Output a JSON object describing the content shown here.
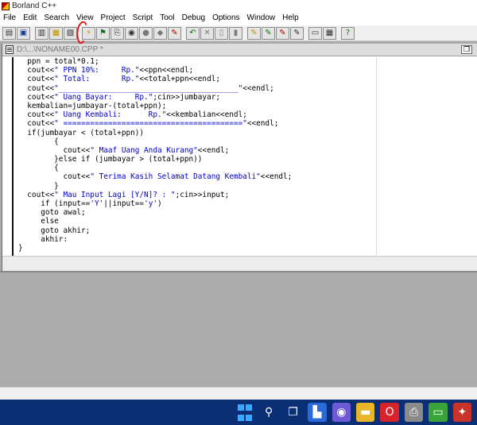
{
  "app": {
    "title": "Borland C++"
  },
  "menu": [
    "File",
    "Edit",
    "Search",
    "View",
    "Project",
    "Script",
    "Tool",
    "Debug",
    "Options",
    "Window",
    "Help"
  ],
  "toolbar": {
    "groups": [
      [
        {
          "name": "new-file-icon",
          "glyph": "▤",
          "tone": "i-dark"
        },
        {
          "name": "open-project-icon",
          "glyph": "▣",
          "tone": "i-blue"
        }
      ],
      [
        {
          "name": "open-file-icon",
          "glyph": "▥",
          "tone": "i-dark"
        },
        {
          "name": "open-folder-icon",
          "glyph": "▦",
          "tone": "i-yellow"
        },
        {
          "name": "save-icon",
          "glyph": "▧",
          "tone": "i-dark"
        }
      ],
      [
        {
          "name": "make-icon",
          "glyph": "⚡",
          "tone": "i-yellow"
        },
        {
          "name": "build-icon",
          "glyph": "⚑",
          "tone": "i-green"
        },
        {
          "name": "compile-icon",
          "glyph": "⎘",
          "tone": "i-dark"
        },
        {
          "name": "run-icon",
          "glyph": "◉",
          "tone": "i-dark"
        },
        {
          "name": "stop-icon",
          "glyph": "●",
          "tone": "i-gray"
        },
        {
          "name": "pause-icon",
          "glyph": "◆",
          "tone": "i-gray"
        },
        {
          "name": "step-icon",
          "glyph": "✎",
          "tone": "i-red"
        }
      ],
      [
        {
          "name": "undo-icon",
          "glyph": "↶",
          "tone": "i-green"
        },
        {
          "name": "cut-icon",
          "glyph": "✕",
          "tone": "i-gray"
        },
        {
          "name": "copy-icon",
          "glyph": "▯",
          "tone": "i-gray"
        },
        {
          "name": "paste-icon",
          "glyph": "▮",
          "tone": "i-gray"
        }
      ],
      [
        {
          "name": "find-icon",
          "glyph": "✎",
          "tone": "i-yellow"
        },
        {
          "name": "find-next-icon",
          "glyph": "✎",
          "tone": "i-green"
        },
        {
          "name": "replace-icon",
          "glyph": "✎",
          "tone": "i-red"
        },
        {
          "name": "search-again-icon",
          "glyph": "✎",
          "tone": "i-dark"
        }
      ],
      [
        {
          "name": "message-window-icon",
          "glyph": "▭",
          "tone": "i-dark"
        },
        {
          "name": "project-window-icon",
          "glyph": "▦",
          "tone": "i-dark"
        }
      ],
      [
        {
          "name": "help-icon",
          "glyph": "?",
          "tone": "i-green"
        }
      ]
    ]
  },
  "editor": {
    "title": "D:\\...\\NONAME00.CPP *",
    "restore_glyph": "❐",
    "lines": [
      [
        {
          "t": "  ppn = total*0.1;"
        }
      ],
      [
        {
          "t": "  cout<<"
        },
        {
          "t": "\" PPN 10%:     Rp.\"",
          "s": 1
        },
        {
          "t": "<<ppn<<endl;"
        }
      ],
      [
        {
          "t": "  cout<<"
        },
        {
          "t": "\" Total:       Rp.\"",
          "s": 1
        },
        {
          "t": "<<total+ppn<<endl;"
        }
      ],
      [
        {
          "t": "  cout<<"
        },
        {
          "t": "\"________________________________________\"",
          "s": 1
        },
        {
          "t": "<<endl;"
        }
      ],
      [
        {
          "t": "  cout<<"
        },
        {
          "t": "\" Uang Bayar:     Rp.\"",
          "s": 1
        },
        {
          "t": ";cin>>jumbayar;"
        }
      ],
      [
        {
          "t": "  kembalian=jumbayar-(total+ppn);"
        }
      ],
      [
        {
          "t": "  cout<<"
        },
        {
          "t": "\" Uang Kembali:      Rp.\"",
          "s": 1
        },
        {
          "t": "<<kembalian<<endl;"
        }
      ],
      [
        {
          "t": "  cout<<"
        },
        {
          "t": "\" ========================================\"",
          "s": 1
        },
        {
          "t": "<<endl;"
        }
      ],
      [
        {
          "t": "  if(jumbayar < (total+ppn))"
        }
      ],
      [
        {
          "t": "        {"
        }
      ],
      [
        {
          "t": "          cout<<"
        },
        {
          "t": "\" Maaf Uang Anda Kurang\"",
          "s": 1
        },
        {
          "t": "<<endl;"
        }
      ],
      [
        {
          "t": "        }else if (jumbayar > (total+ppn))"
        }
      ],
      [
        {
          "t": "        {"
        }
      ],
      [
        {
          "t": "          cout<<"
        },
        {
          "t": "\" Terima Kasih Selamat Datang Kembali\"",
          "s": 1
        },
        {
          "t": "<<endl;"
        }
      ],
      [
        {
          "t": "        }"
        }
      ],
      [
        {
          "t": "  cout<<"
        },
        {
          "t": "\" Mau Input Lagi [Y/N]? : \"",
          "s": 1
        },
        {
          "t": ";cin>>input;"
        }
      ],
      [
        {
          "t": "     if (input=="
        },
        {
          "t": "'Y'",
          "s": 1
        },
        {
          "t": "||input=="
        },
        {
          "t": "'y'",
          "s": 1
        },
        {
          "t": ")"
        }
      ],
      [
        {
          "t": "     goto awal;"
        }
      ],
      [
        {
          "t": "     else"
        }
      ],
      [
        {
          "t": "     goto akhir;"
        }
      ],
      [
        {
          "t": "     akhir:"
        }
      ],
      [
        {
          "t": "}"
        }
      ]
    ]
  },
  "taskbar": {
    "items": [
      {
        "name": "start-icon",
        "glyph": "",
        "bg": "transparent"
      },
      {
        "name": "search-icon",
        "glyph": "⚲",
        "bg": "transparent"
      },
      {
        "name": "task-view-icon",
        "glyph": "❐",
        "bg": "transparent"
      },
      {
        "name": "widgets-icon",
        "glyph": "▙",
        "bg": "#2a6ad8"
      },
      {
        "name": "teams-chat-icon",
        "glyph": "◉",
        "bg": "#6b5bd6"
      },
      {
        "name": "file-explorer-icon",
        "glyph": "▬",
        "bg": "#e8b628"
      },
      {
        "name": "opera-browser-icon",
        "glyph": "O",
        "bg": "#d8232a"
      },
      {
        "name": "printer-app-icon",
        "glyph": "⎙",
        "bg": "#8a8a8a"
      },
      {
        "name": "monitor-app-icon",
        "glyph": "▭",
        "bg": "#3aa33a"
      },
      {
        "name": "borland-app-icon",
        "glyph": "✦",
        "bg": "#c8342a"
      }
    ]
  }
}
